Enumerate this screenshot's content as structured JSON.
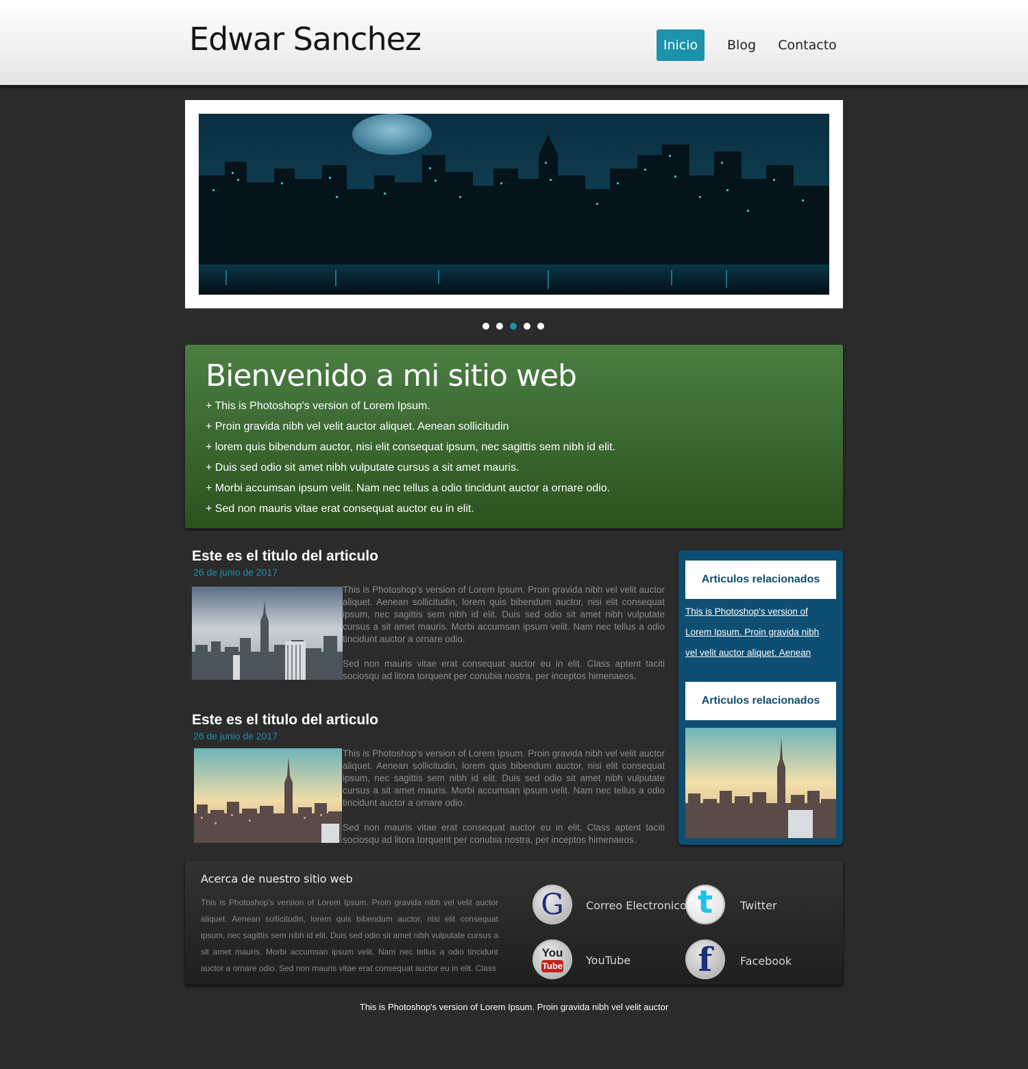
{
  "header": {
    "site_title": "Edwar Sanchez",
    "nav": [
      {
        "label": "Inicio",
        "active": true
      },
      {
        "label": "Blog",
        "active": false
      },
      {
        "label": "Contacto",
        "active": false
      }
    ]
  },
  "slider": {
    "dot_count": 5,
    "active_dot": 3
  },
  "welcome": {
    "title": "Bienvenido a mi sitio web",
    "items": [
      "+ This is Photoshop's version  of Lorem Ipsum.",
      "+ Proin gravida nibh vel velit auctor aliquet. Aenean sollicitudin",
      "+ lorem quis bibendum auctor, nisi elit consequat ipsum, nec sagittis sem nibh id elit.",
      "+ Duis sed odio sit amet nibh vulputate cursus a sit amet mauris.",
      "+ Morbi accumsan ipsum velit. Nam nec tellus a odio tincidunt auctor a ornare odio.",
      "+ Sed non  mauris vitae erat consequat auctor eu in elit."
    ]
  },
  "articles": [
    {
      "title": "Este es el titulo del articulo",
      "date": "26 de junio de 2017",
      "paragraph1": "This is Photoshop's version  of Lorem Ipsum. Proin gravida nibh vel velit auctor aliquet. Aenean sollicitudin, lorem quis bibendum auctor, nisi elit consequat ipsum, nec sagittis sem nibh id elit. Duis sed odio sit amet nibh vulputate cursus a sit amet mauris. Morbi accumsan ipsum velit. Nam nec tellus a odio tincidunt auctor a ornare odio.",
      "paragraph2": "Sed non  mauris vitae erat consequat auctor eu in elit. Class aptent taciti sociosqu ad litora torquent per conubia nostra, per inceptos himenaeos."
    },
    {
      "title": "Este es el titulo del articulo",
      "date": "26 de junio de 2017",
      "paragraph1": "This is Photoshop's version  of Lorem Ipsum. Proin gravida nibh vel velit auctor aliquet. Aenean sollicitudin, lorem quis bibendum auctor, nisi elit consequat ipsum, nec sagittis sem nibh id elit. Duis sed odio sit amet nibh vulputate cursus a sit amet mauris. Morbi accumsan ipsum velit. Nam nec tellus a odio tincidunt auctor a ornare odio.",
      "paragraph2": "Sed non  mauris vitae erat consequat auctor eu in elit. Class aptent taciti sociosqu ad litora torquent per conubia nostra, per inceptos himenaeos."
    }
  ],
  "sidebar": {
    "heading1": "Articulos relacionados",
    "links": [
      "This is Photoshop's version  of",
      "Lorem Ipsum. Proin gravida nibh",
      "vel velit auctor aliquet. Aenean"
    ],
    "heading2": "Articulos relacionados"
  },
  "footer": {
    "about_title": "Acerca de nuestro sitio web",
    "about_text": "This is Photoshop's version  of Lorem Ipsum. Proin gravida nibh vel velit auctor aliquet. Aenean sollicitudin, lorem quis bibendum auctor, nisi elit consequat ipsum, nec sagittis sem nibh id elit. Duis sed odio sit amet nibh vulputate cursus a sit amet mauris. Morbi accumsan ipsum velit. Nam nec tellus a odio tincidunt auctor a ornare odio. Sed non  mauris vitae erat consequat auctor eu in elit. Class",
    "social": {
      "email": {
        "label": "Correo Electronico",
        "icon": "google-icon",
        "glyph": "G"
      },
      "twitter": {
        "label": "Twitter",
        "icon": "twitter-icon",
        "glyph": "t"
      },
      "youtube": {
        "label": "YouTube",
        "icon": "youtube-icon",
        "glyph_top": "You",
        "glyph_bottom": "Tube"
      },
      "facebook": {
        "label": "Facebook",
        "icon": "facebook-icon",
        "glyph": "f"
      }
    },
    "copyright": "This is Photoshop's version  of Lorem Ipsum. Proin gravida nibh vel velit auctor"
  },
  "colors": {
    "accent": "#1c93ab",
    "welcome_top": "#4b7e43",
    "welcome_bottom": "#2c521f",
    "sidebar": "#0e4e72",
    "background": "#2b2b2b"
  }
}
